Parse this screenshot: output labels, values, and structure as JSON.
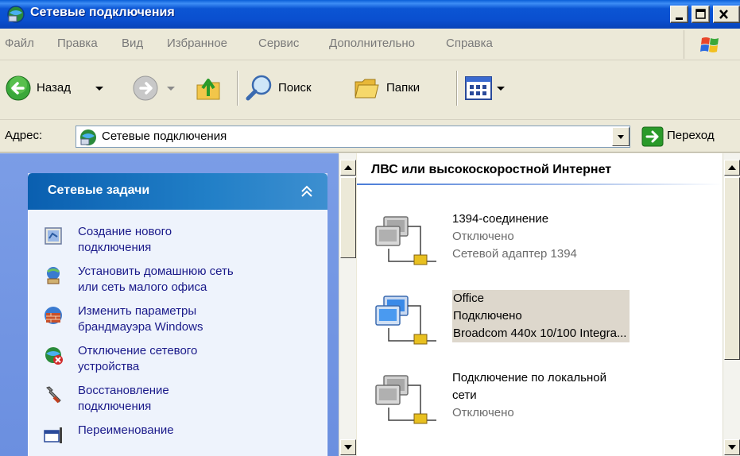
{
  "window": {
    "title": "Сетевые подключения"
  },
  "menu": {
    "items": [
      "Файл",
      "Правка",
      "Вид",
      "Избранное",
      "Сервис",
      "Дополнительно",
      "Справка"
    ]
  },
  "toolbar": {
    "back_label": "Назад",
    "search_label": "Поиск",
    "folders_label": "Папки"
  },
  "address": {
    "label": "Адрес:",
    "value": "Сетевые подключения",
    "go_label": "Переход"
  },
  "tasks": {
    "header": "Сетевые задачи",
    "items": [
      {
        "line1": "Создание нового",
        "line2": "подключения",
        "icon": "new-connection-icon"
      },
      {
        "line1": "Установить домашнюю сеть",
        "line2": "или сеть малого офиса",
        "icon": "home-network-icon"
      },
      {
        "line1": "Изменить параметры",
        "line2": "брандмауэра Windows",
        "icon": "firewall-icon"
      },
      {
        "line1": "Отключение сетевого",
        "line2": "устройства",
        "icon": "disable-device-icon"
      },
      {
        "line1": "Восстановление",
        "line2": "подключения",
        "icon": "repair-icon"
      },
      {
        "line1": "Переименование",
        "line2": "",
        "icon": "rename-icon"
      }
    ]
  },
  "connections": {
    "group_title": "ЛВС или высокоскоростной Интернет",
    "items": [
      {
        "name": "1394-соединение",
        "status": "Отключено",
        "device": "Сетевой адаптер 1394",
        "connected": false,
        "selected": false
      },
      {
        "name": "Office",
        "status": "Подключено",
        "device": "Broadcom 440x 10/100 Integra...",
        "connected": true,
        "selected": true
      },
      {
        "name": "Подключение по локальной",
        "name2": "сети",
        "status": "Отключено",
        "connected": false,
        "selected": false
      }
    ]
  },
  "colors": {
    "titlebar": "#0a4fcf",
    "task_header": "#217fc7",
    "task_link": "#1a1a8a",
    "selection": "#ddd7cc"
  }
}
